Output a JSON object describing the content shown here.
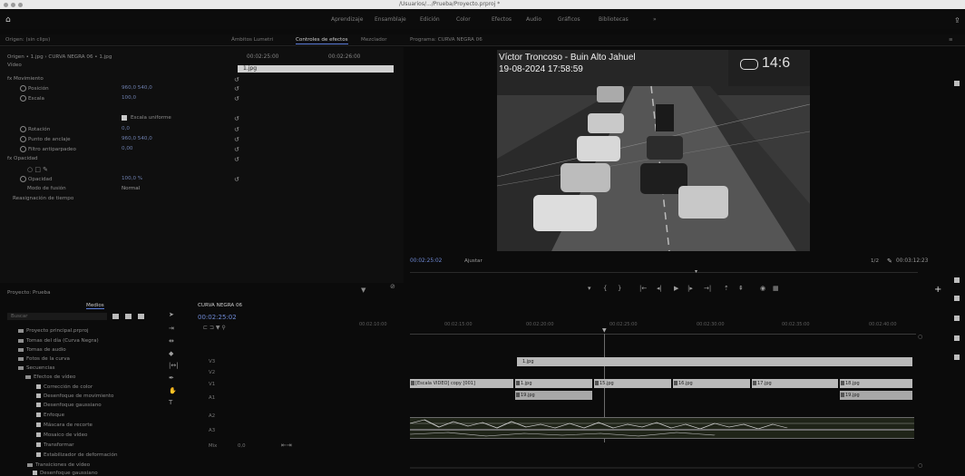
{
  "titlebar": {
    "title": "/Usuarios/.../Prueba/Proyecto.prproj *"
  },
  "workspaces": [
    "Aprendizaje",
    "Ensamblaje",
    "Edición",
    "Color",
    "Efectos",
    "Audio",
    "Gráficos",
    "Bibliotecas",
    "»"
  ],
  "tabs": {
    "source": "Origen: (sin clips)",
    "lumetri": "Ámbitos Lumetri",
    "effect_controls": "Controles de efectos",
    "audio_mixer": "Mezclador",
    "program": "Programa: CURVA NEGRA 06"
  },
  "effect_controls": {
    "header": "Origen • 1.jpg  ›  CURVA NEGRA 06 • 1.jpg",
    "section": "Vídeo",
    "mini_tc_start": "00:02:25:00",
    "mini_tc_end": "00:02:26:00",
    "clip_label": "1.jpg",
    "rows": [
      {
        "label": "fx  Movimiento",
        "value": ""
      },
      {
        "label": "Posición",
        "value": "960,0   540,0"
      },
      {
        "label": "Escala",
        "value": "100,0"
      },
      {
        "label": "Escala uniforme",
        "value": ""
      },
      {
        "label": "Rotación",
        "value": "0,0"
      },
      {
        "label": "Punto de anclaje",
        "value": "960,0   540,0"
      },
      {
        "label": "Filtro antiparpadeo",
        "value": "0,00"
      },
      {
        "label": "fx  Opacidad",
        "value": ""
      },
      {
        "label": "Opacidad",
        "value": "100,0 %"
      },
      {
        "label": "Modo de fusión",
        "value": "Normal"
      },
      {
        "label": "Reasignación de tiempo",
        "value": ""
      }
    ]
  },
  "program": {
    "overlay_name": "Víctor Troncoso - Buin Alto Jahuel",
    "overlay_datetime": "19-08-2024 17:58:59",
    "overlay_clock": "14:6",
    "timecode_current": "00:02:25:02",
    "fit_label": "Ajustar",
    "quality": "1/2",
    "timecode_total": "00:03:12:23"
  },
  "transport_icons": [
    "marker-icon",
    "in-point-icon",
    "out-point-icon",
    "go-in-icon",
    "step-back-icon",
    "play-icon",
    "step-forward-icon",
    "go-out-icon",
    "lift-icon",
    "extract-icon",
    "export-frame-icon",
    "compare-icon"
  ],
  "project": {
    "title": "Proyecto: Prueba",
    "tab_media": "Medios",
    "search_placeholder": "Buscar",
    "items": [
      "Proyecto principal.prproj",
      "Tomas del día (Curva Negra)",
      "Tomas de audio",
      "Fotos de la curva",
      "Secuencias",
      "Efectos de vídeo",
      "Transiciones de vídeo",
      "Desenfoque gaussiano"
    ],
    "bin_items": [
      "Corrección de color",
      "Desenfoque de movimiento",
      "Desenfoque gaussiano",
      "Enfoque",
      "Máscara de recorte",
      "Mosaico de vídeo",
      "Transformar",
      "Estabilizador de deformación"
    ]
  },
  "timeline": {
    "sequence_tab": "CURVA NEGRA 06",
    "timecode": "00:02:25:02",
    "ruler": [
      "00:02:10:00",
      "00:02:15:00",
      "00:02:20:00",
      "00:02:25:00",
      "00:02:30:00",
      "00:02:35:00",
      "00:02:40:00"
    ],
    "tracks": [
      "V3",
      "V2",
      "V1",
      "A1",
      "A2",
      "A3",
      "Mix"
    ],
    "clips_v3": [
      {
        "label": "1.jpg"
      }
    ],
    "clips_v2": [
      {
        "label": "[Escala VIDEO] copy [001]"
      },
      {
        "label": "1.jpg"
      },
      {
        "label": "15.jpg"
      },
      {
        "label": "16.jpg"
      },
      {
        "label": "17.jpg"
      },
      {
        "label": "18.jpg"
      }
    ],
    "clips_v1": [
      {
        "label": "19.jpg"
      },
      {
        "label": "19.jpg"
      }
    ],
    "mix_value": "0,0"
  }
}
